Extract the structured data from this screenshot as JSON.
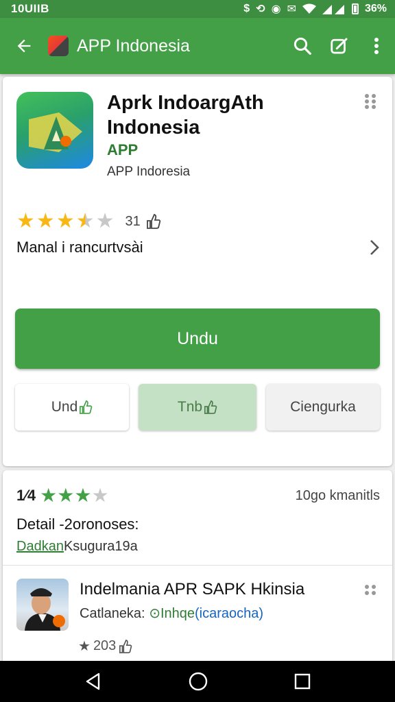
{
  "status_bar": {
    "time": "10UIIB",
    "battery": "36%"
  },
  "app_bar": {
    "title": "APP Indonesia"
  },
  "app": {
    "name": "Aprk IndoargAth Indonesia",
    "tag": "APP",
    "developer": "APP Indoresia",
    "rating_count": "31",
    "info_label": "Manal i rancurtvsài"
  },
  "buttons": {
    "install": "Undu",
    "secondary_1": "Und",
    "secondary_2": "Tnb",
    "secondary_3": "Ciengurka"
  },
  "reviews": {
    "score": "1⁄4",
    "label": "10go kmanitls",
    "detail": "Detail -2oronoses:",
    "link": "Dadkan",
    "link_rest": "Ksugura19a"
  },
  "related": {
    "title": "Indelmania APR SAPK Hkinsia",
    "category_label": "Catlaneka:",
    "status": "Inhqe",
    "extra": "(icaraocha)",
    "rating": "203"
  },
  "colors": {
    "primary": "#43a047",
    "statusbar": "#3e8e41",
    "star": "#f9b715"
  }
}
